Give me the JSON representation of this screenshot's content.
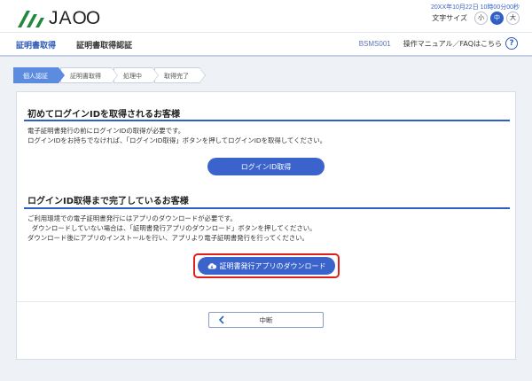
{
  "header": {
    "logo_text": "JA",
    "logo_suffix": "OO",
    "datetime": "20XX年10月22日 10時00分00秒",
    "font_size_label": "文字サイズ",
    "font_sizes": [
      "小",
      "中",
      "大"
    ],
    "active_font_size": "中"
  },
  "subheader": {
    "nav1": "証明書取得",
    "nav2": "証明書取得認証",
    "screen_id": "BSMS001",
    "manual_link": "操作マニュアル／FAQはこちら",
    "help_glyph": "?"
  },
  "steps": [
    "個人認証",
    "証明書取得",
    "処理中",
    "取得完了"
  ],
  "section1": {
    "title": "初めてログインIDを取得されるお客様",
    "text": "電子証明書発行の前にログインIDの取得が必要です。\nログインIDをお持ちでなければ、「ログインID取得」ボタンを押してログインIDを取得してください。",
    "button": "ログインID取得"
  },
  "section2": {
    "title": "ログインID取得まで完了しているお客様",
    "text": "ご利用環境での電子証明書発行にはアプリのダウンロードが必要です。\n  ダウンロードしていない場合は、「証明書発行アプリのダウンロード」ボタンを押してください。\nダウンロード後にアプリのインストールを行い、アプリより電子証明書発行を行ってください。",
    "button": "証明書発行アプリのダウンロード"
  },
  "cancel_button": "中断",
  "colors": {
    "accent": "#2f5fc4",
    "button": "#3a63cc",
    "step_active": "#5c8ce0",
    "highlight": "#e01e1e",
    "logo_green": "#1f8a3d"
  }
}
